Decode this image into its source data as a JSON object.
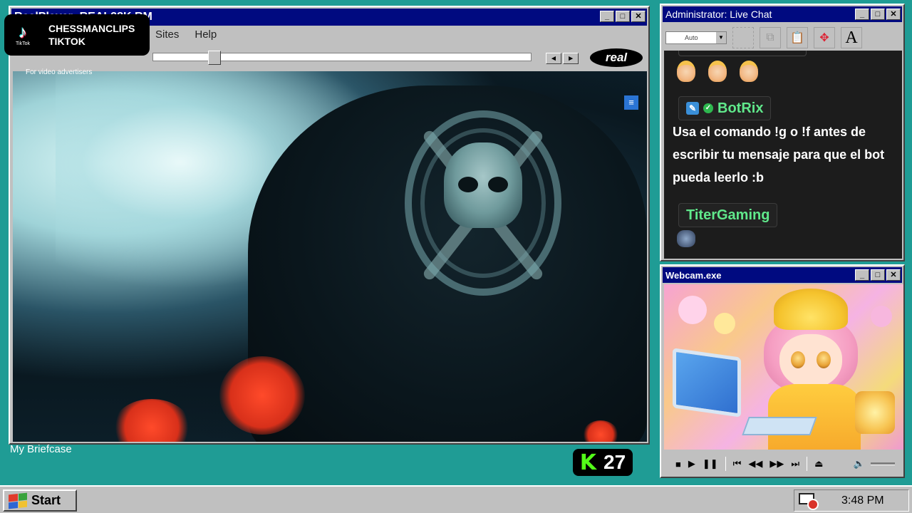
{
  "realplayer": {
    "title": "RealPlayer: REAL28K.RM",
    "menu": [
      "Sites",
      "Help"
    ],
    "ad_text": "For video advertisers",
    "logo_text": "real",
    "seek_progress": 0.15
  },
  "overlay": {
    "tiktok_logo_text": "TikTok",
    "tiktok_line1": "CHESSMANCLIPS",
    "tiktok_line2": "TIKTOK",
    "kick_letter": "K",
    "kick_count": "27"
  },
  "desktop": {
    "briefcase_label": "My Briefcase"
  },
  "chat": {
    "title": "Administrator: Live Chat",
    "dropdown_value": "Auto",
    "tool_text_icon": "A",
    "messages": [
      {
        "user": "BotRix",
        "text": "Usa el comando !g o !f antes de escribir tu mensaje para que el bot pueda leerlo :b"
      },
      {
        "user": "TiterGaming",
        "text": ""
      }
    ]
  },
  "webcam": {
    "title": "Webcam.exe",
    "controls": [
      "stop-icon",
      "play-icon",
      "pause-icon",
      "skip-back-icon",
      "rewind-icon",
      "fast-forward-icon",
      "skip-forward-icon",
      "eject-icon",
      "volume-icon"
    ]
  },
  "taskbar": {
    "start_label": "Start",
    "clock": "3:48 PM"
  },
  "colors": {
    "desktop": "#1f9c95",
    "titlebar": "#000a80",
    "chat_bg": "#1c1c1c",
    "username": "#60e88b",
    "kick_green": "#53fc18"
  }
}
